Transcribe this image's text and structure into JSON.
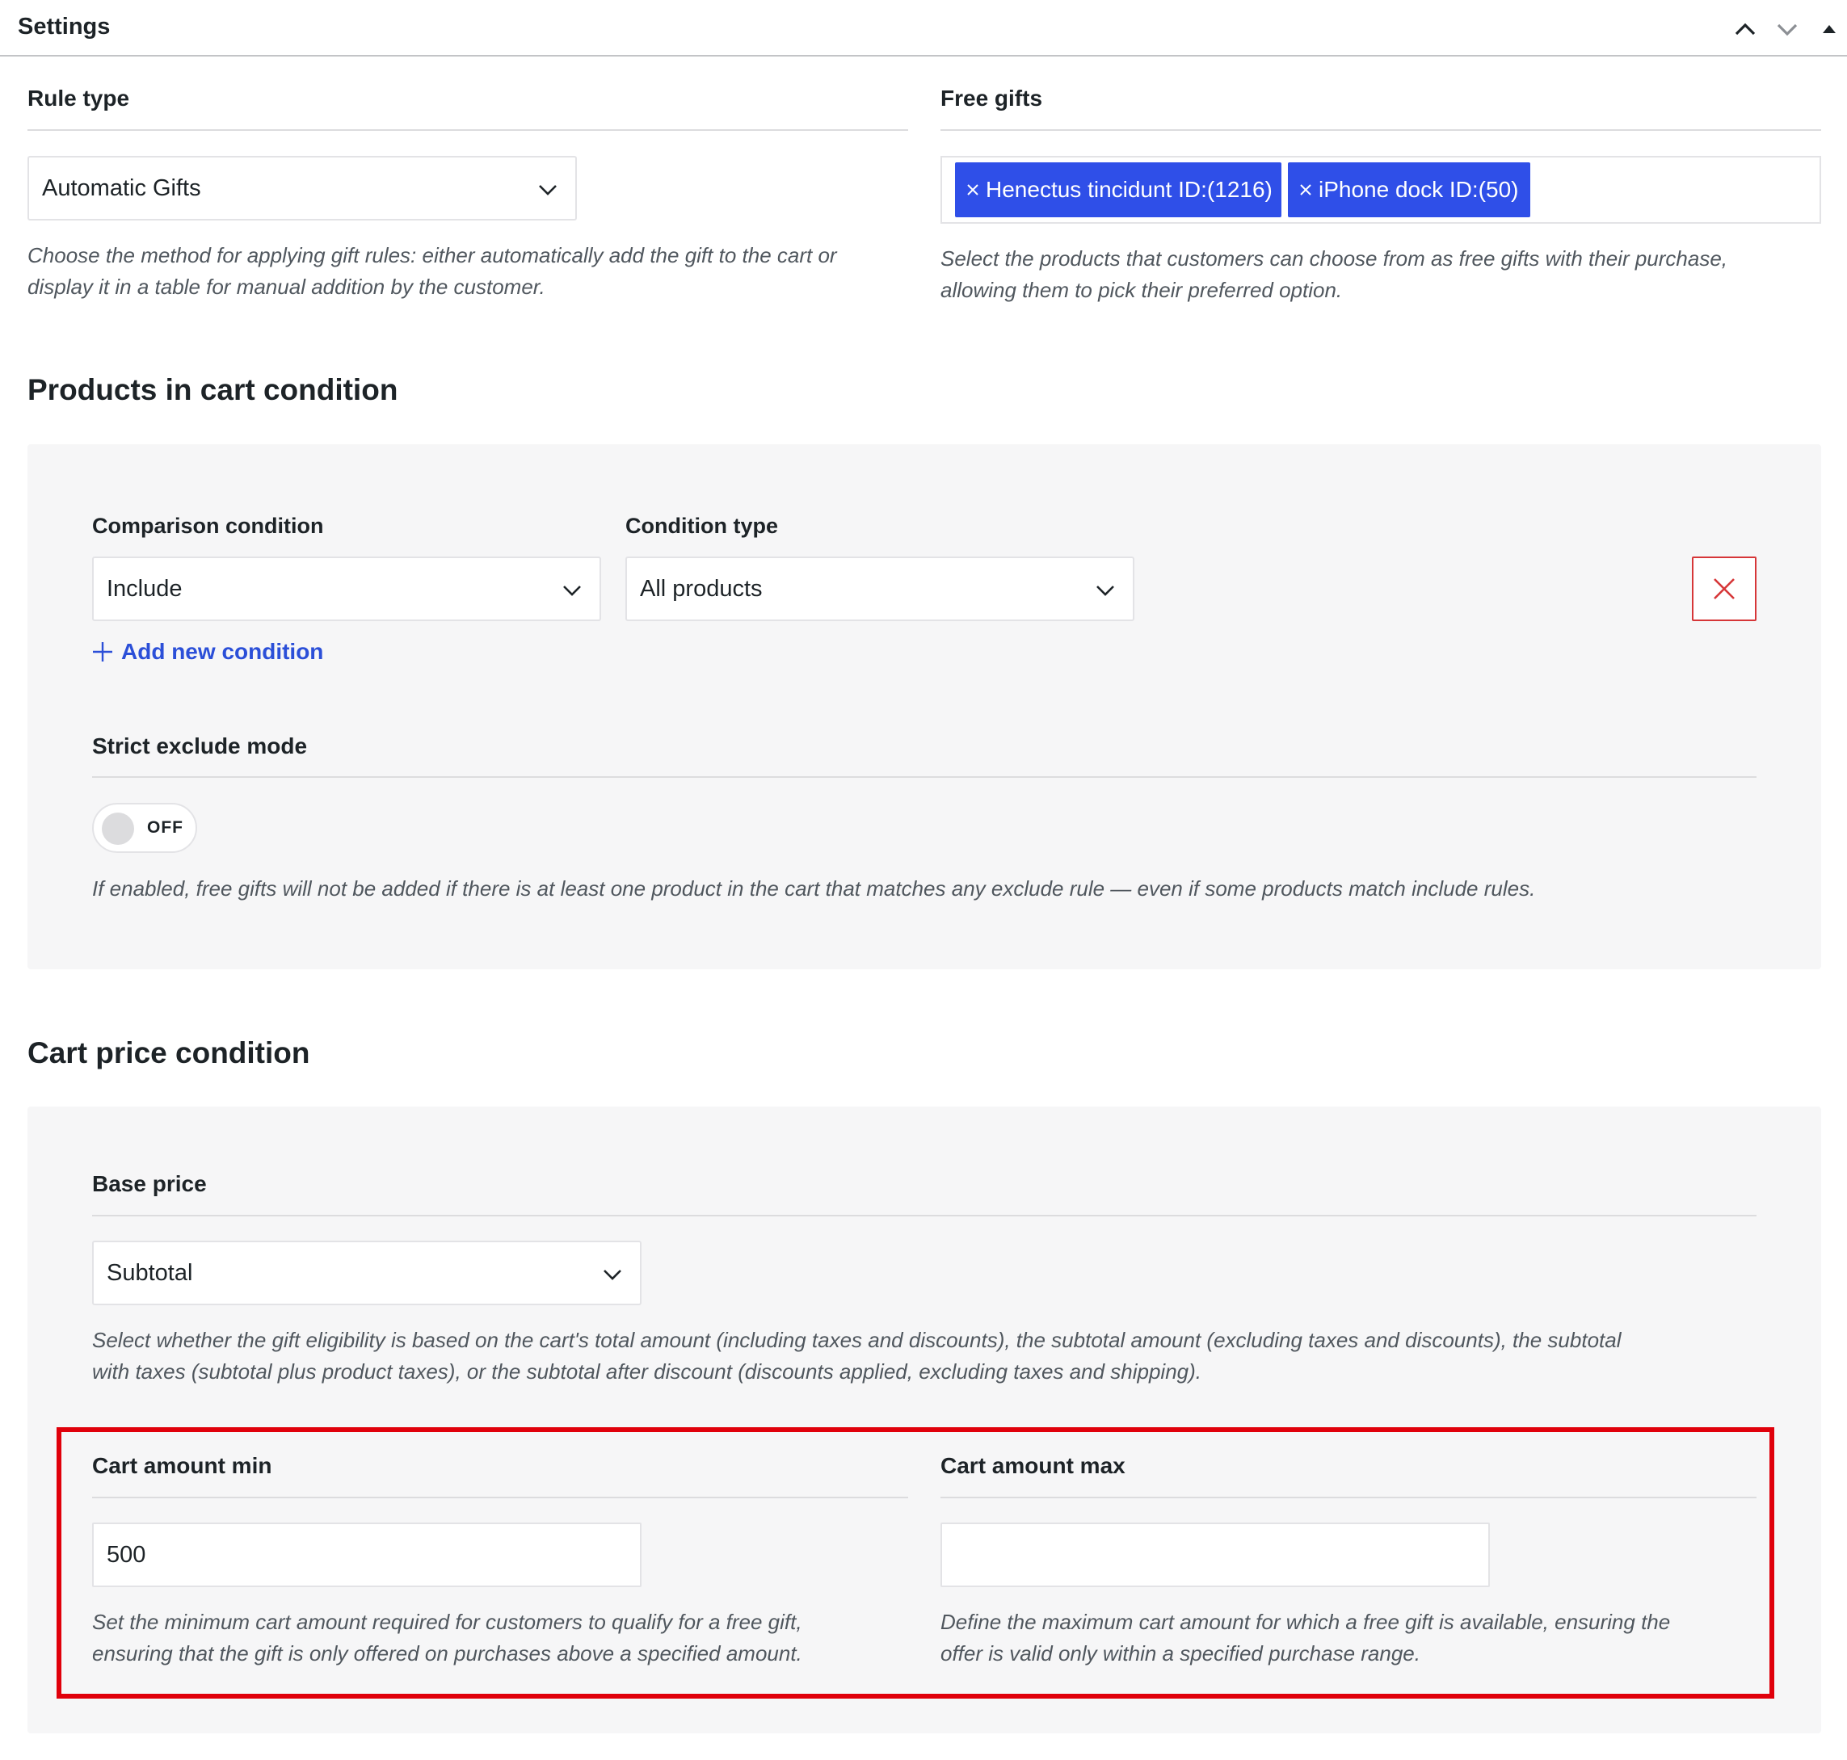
{
  "header": {
    "title": "Settings",
    "icons": [
      "chevron-up-icon",
      "chevron-down-icon",
      "triangle-up-icon"
    ]
  },
  "rule_type": {
    "label": "Rule type",
    "selected": "Automatic Gifts",
    "description_line1": "Choose the method for applying gift rules: either automatically add the gift to the cart or",
    "description_line2": "display it in a table for manual addition by the customer."
  },
  "free_gifts": {
    "label": "Free gifts",
    "tags": [
      {
        "label": "Henectus tincidunt ID:(1216)"
      },
      {
        "label": "iPhone dock ID:(50)"
      }
    ],
    "description_line1": "Select the products that customers can choose from as free gifts with their purchase,",
    "description_line2": "allowing them to pick their preferred option."
  },
  "products_condition": {
    "title": "Products in cart condition",
    "comparison_label": "Comparison condition",
    "comparison_value": "Include",
    "condition_type_label": "Condition type",
    "condition_type_value": "All products",
    "add_new_label": "Add new condition",
    "strict_label": "Strict exclude mode",
    "toggle_text": "OFF",
    "strict_description": "If enabled, free gifts will not be added if there is at least one product in the cart that matches any exclude rule — even if some products match include rules."
  },
  "cart_price": {
    "title": "Cart price condition",
    "base_price_label": "Base price",
    "base_price_value": "Subtotal",
    "base_description_line1": "Select whether the gift eligibility is based on the cart's total amount (including taxes and discounts), the subtotal amount (excluding taxes and discounts), the subtotal",
    "base_description_line2": "with taxes (subtotal plus product taxes), or the subtotal after discount (discounts applied, excluding taxes and shipping).",
    "min_label": "Cart amount min",
    "min_value": "500",
    "min_description_line1": "Set the minimum cart amount required for customers to qualify for a free gift,",
    "min_description_line2": "ensuring that the gift is only offered on purchases above a specified amount.",
    "max_label": "Cart amount max",
    "max_value": "",
    "max_description_line1": "Define the maximum cart amount for which a free gift is available, ensuring the",
    "max_description_line2": "offer is valid only within a specified purchase range."
  },
  "colors": {
    "tag_bg": "#2f4fe8",
    "link": "#2b4fd8",
    "delete": "#d63638",
    "highlight": "#e0000b",
    "panel_bg": "#f6f6f7"
  }
}
